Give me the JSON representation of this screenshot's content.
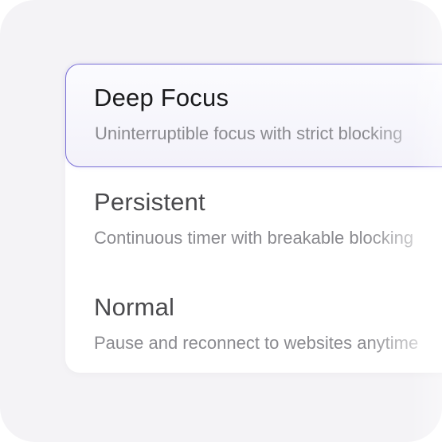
{
  "modes": [
    {
      "title": "Deep Focus",
      "description": "Uninterruptible focus with strict blocking",
      "selected": true
    },
    {
      "title": "Persistent",
      "description": "Continuous timer with breakable blocking",
      "selected": false
    },
    {
      "title": "Normal",
      "description": "Pause and reconnect to websites anytime",
      "selected": false
    }
  ],
  "colors": {
    "accent": "#7a6fd6",
    "background": "#f4f3f6",
    "panel": "#ffffff"
  }
}
